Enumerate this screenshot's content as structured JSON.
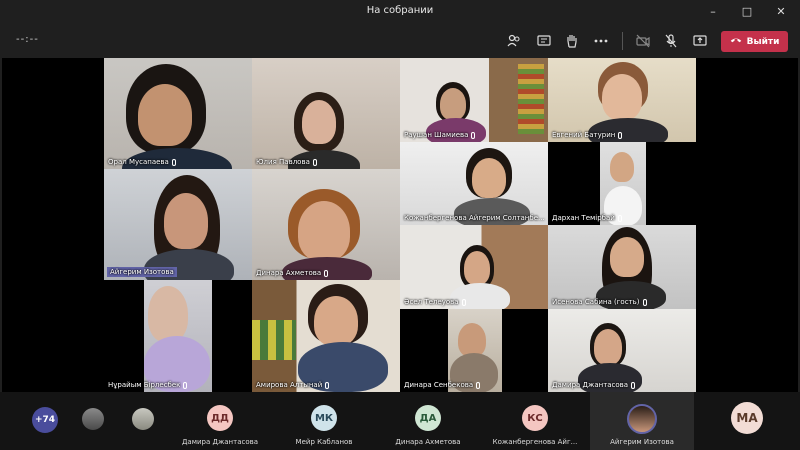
{
  "window": {
    "title": "На собрании"
  },
  "toolbar": {
    "timer": "--:--",
    "leave_label": "Выйти"
  },
  "tiles": [
    {
      "name": "Орал Мусапаева"
    },
    {
      "name": "Юлия Павлова"
    },
    {
      "name": "Раушан Шамиева"
    },
    {
      "name": "Евгений Батурин"
    },
    {
      "name": "Кожанбергенова Айгерим Солтанбе..."
    },
    {
      "name": "Дархан Темірбай"
    },
    {
      "name": "Айгерим Изотова"
    },
    {
      "name": "Динара Ахметова"
    },
    {
      "name": "Әсел Телеуова"
    },
    {
      "name": "Исенова Сабина (гость)"
    },
    {
      "name": "Нұрайым Бірлесбек"
    },
    {
      "name": "Амирова Алтынай"
    },
    {
      "name": "Динара Сенбекова"
    },
    {
      "name": "Дамира Джантасова"
    }
  ],
  "bottom": {
    "more_count": "+74",
    "participants": [
      {
        "initials": "ДД",
        "name": "Дамира Джантасова",
        "color": "#f4c6c1"
      },
      {
        "initials": "МК",
        "name": "Мейр Кабланов",
        "color": "#cfe3ea"
      },
      {
        "initials": "ДА",
        "name": "Динара Ахметова",
        "color": "#cfe6d3"
      },
      {
        "initials": "КС",
        "name": "Кожанбергенова Айг...",
        "color": "#f4c6c1"
      },
      {
        "initials": "",
        "name": "Айгерим Изотова",
        "color": "#6264a7"
      },
      {
        "initials": "МА",
        "name": "",
        "color": "#f2dcd5"
      }
    ]
  },
  "colors": {
    "accent": "#6264a7",
    "leave": "#c4314b"
  }
}
